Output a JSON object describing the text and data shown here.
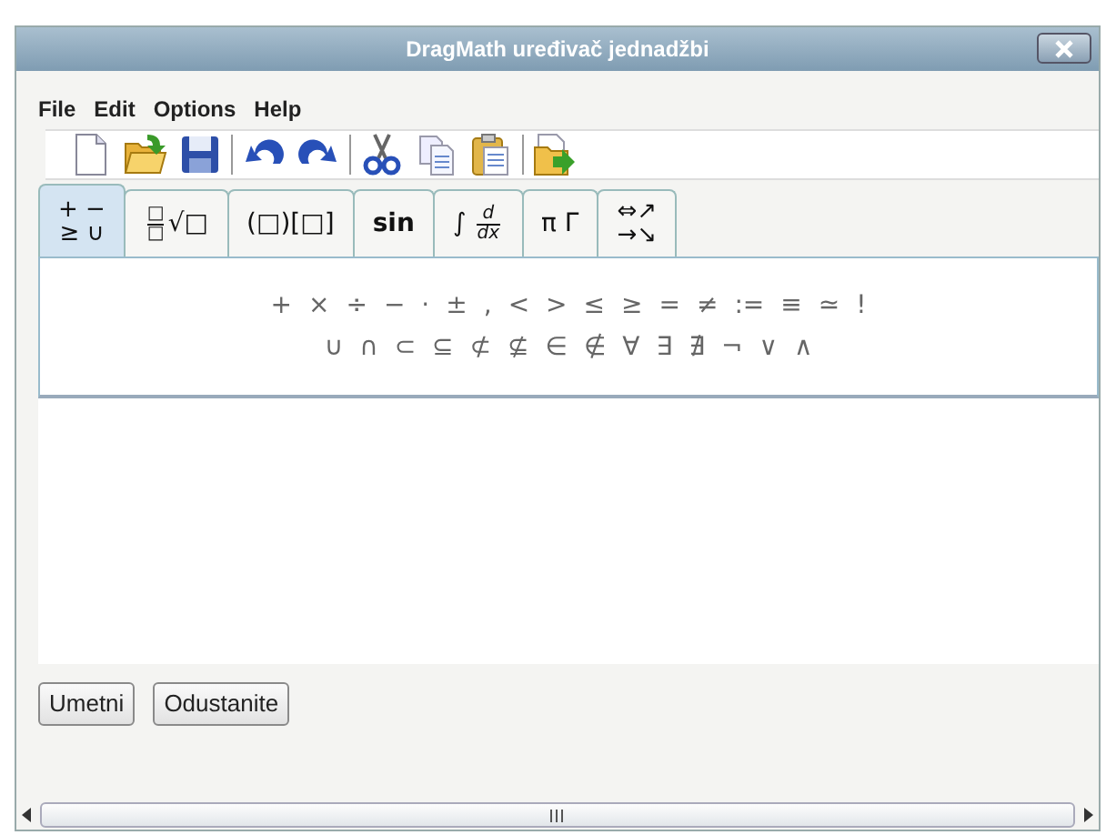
{
  "window": {
    "title": "DragMath uređivač jednadžbi"
  },
  "menu": [
    "File",
    "Edit",
    "Options",
    "Help"
  ],
  "tabs": [
    {
      "kind": "stack",
      "lines": [
        "+ −",
        "≥ ∪"
      ],
      "selected": true
    },
    {
      "kind": "fraction",
      "numerator": "□",
      "denominator": "□",
      "suffix": "√□",
      "selected": false
    },
    {
      "kind": "text",
      "text": "(□)[□]",
      "selected": false
    },
    {
      "kind": "text",
      "text": "sin",
      "selected": false
    },
    {
      "kind": "fraction",
      "prefix": "∫",
      "numerator": "d",
      "denominator": "dx",
      "selected": false
    },
    {
      "kind": "text",
      "text": "π Γ",
      "selected": false
    },
    {
      "kind": "stack",
      "lines": [
        "⇔↗",
        "→↘"
      ],
      "selected": false
    }
  ],
  "palette": [
    [
      "+",
      "×",
      "÷",
      "−",
      "·",
      "±",
      ",",
      "<",
      ">",
      "≤",
      "≥",
      "=",
      "≠",
      ":=",
      "≡",
      "≃",
      "!"
    ],
    [
      "∪",
      "∩",
      "⊂",
      "⊆",
      "⊄",
      "⊈",
      "∈",
      "∉",
      "∀",
      "∃",
      "∄",
      "¬",
      "∨",
      "∧"
    ]
  ],
  "buttons": [
    "Umetni",
    "Odustanite"
  ]
}
